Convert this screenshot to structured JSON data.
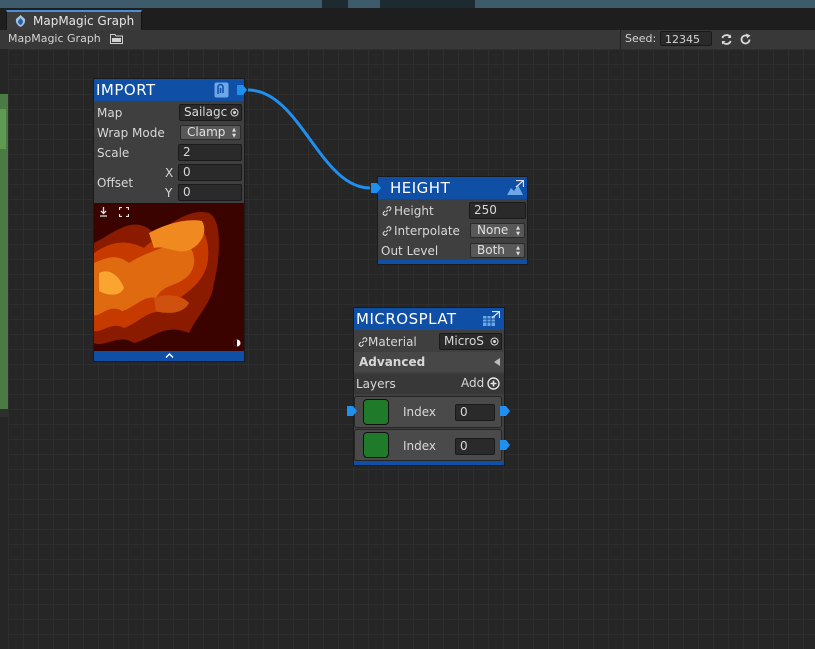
{
  "window": {
    "tab_label": "MapMagic Graph"
  },
  "toolbar": {
    "title": "MapMagic Graph",
    "seed_label": "Seed:",
    "seed_value": "12345"
  },
  "nodes": {
    "import": {
      "title": "IMPORT",
      "map_label": "Map",
      "map_value": "Sailagc",
      "wrap_label": "Wrap Mode",
      "wrap_value": "Clamp",
      "scale_label": "Scale",
      "scale_value": "2",
      "offset_label": "Offset",
      "x_label": "X",
      "x_value": "0",
      "y_label": "Y",
      "y_value": "0"
    },
    "height": {
      "title": "HEIGHT",
      "height_label": "Height",
      "height_value": "250",
      "interpolate_label": "Interpolate",
      "interpolate_value": "None",
      "outlevel_label": "Out Level",
      "outlevel_value": "Both"
    },
    "microsplat": {
      "title": "MICROSPLAT",
      "material_label": "Material",
      "material_value": "MicroS",
      "advanced_label": "Advanced",
      "layers_label": "Layers",
      "add_label": "Add",
      "layers": [
        {
          "index_label": "Index",
          "index_value": "0"
        },
        {
          "index_label": "Index",
          "index_value": "0"
        }
      ]
    }
  },
  "colors": {
    "node_header": "#0f4fa6",
    "wire": "#1f8ff0",
    "layer_swatch": "#1f7a2a"
  }
}
